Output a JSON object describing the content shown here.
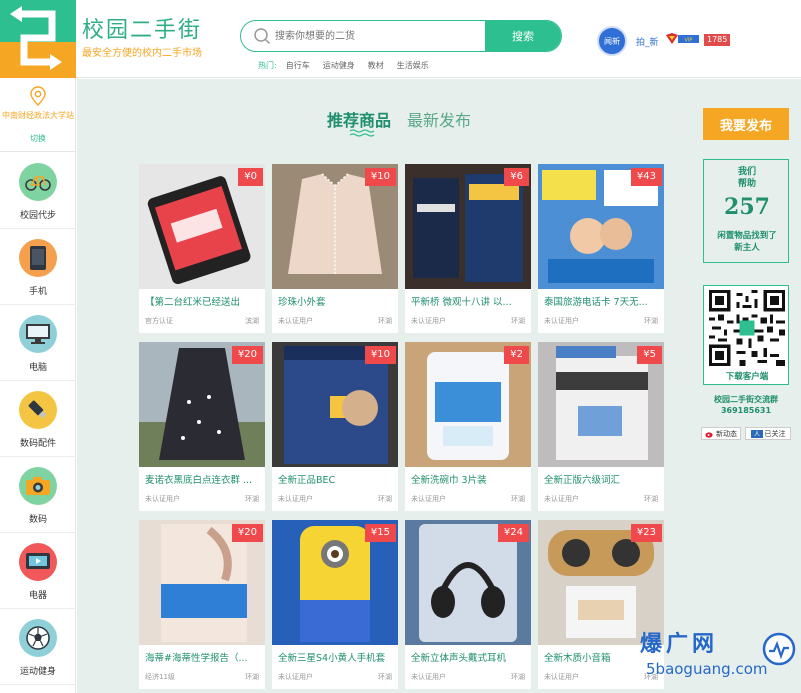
{
  "header": {
    "site_title": "校园二手街",
    "site_slogan": "最安全方便的校内二手市场",
    "search": {
      "placeholder": "搜索你想要的二货",
      "button_label": "搜索"
    },
    "hot_label": "热门:",
    "hot_tags": [
      "自行车",
      "运动健身",
      "教材",
      "生活娱乐"
    ],
    "user": {
      "avatar_text": "闻新",
      "name": "拍_新",
      "points": "1785"
    }
  },
  "sidebar": {
    "location_name": "中南财经政法大学站",
    "location_switch": "切换",
    "categories": [
      {
        "label": "校园代步",
        "icon": "bicycle-icon",
        "color": "#7fd3a1"
      },
      {
        "label": "手机",
        "icon": "phone-icon",
        "color": "#f5a04c"
      },
      {
        "label": "电脑",
        "icon": "computer-icon",
        "color": "#8fd0d8"
      },
      {
        "label": "数码配件",
        "icon": "usb-drive-icon",
        "color": "#f4c542"
      },
      {
        "label": "数码",
        "icon": "camera-icon",
        "color": "#7fd3a1"
      },
      {
        "label": "电器",
        "icon": "tv-icon",
        "color": "#f0585a"
      },
      {
        "label": "运动健身",
        "icon": "soccer-ball-icon",
        "color": "#8fd0d8"
      }
    ]
  },
  "tabs": {
    "recommended": "推荐商品",
    "latest": "最新发布"
  },
  "products": [
    {
      "price": "¥0",
      "title": "【第二台红米已经送出",
      "seller": "官方认证",
      "area": "滨湖",
      "bg": "#2a2a2a",
      "accent": "#e8434a"
    },
    {
      "price": "¥10",
      "title": "珍珠小外套",
      "seller": "未认证用户",
      "area": "环湖",
      "bg": "#8a7560",
      "accent": "#e9d4c6"
    },
    {
      "price": "¥6",
      "title": "平新桥 微观十八讲 以...",
      "seller": "未认证用户",
      "area": "环湖",
      "bg": "#3a2f2a",
      "accent": "#1b2a48"
    },
    {
      "price": "¥43",
      "title": "泰国旅游电话卡 7天无...",
      "seller": "未认证用户",
      "area": "环湖",
      "bg": "#3a7fc6",
      "accent": "#f4e04a"
    },
    {
      "price": "¥20",
      "title": "麦诺衣黑底白点连衣群 ...",
      "seller": "未认证用户",
      "area": "环湖",
      "bg": "#9aa3a8",
      "accent": "#2b2b33"
    },
    {
      "price": "¥10",
      "title": "全新正品BEC",
      "seller": "未认证用户",
      "area": "环湖",
      "bg": "#2c4a8a",
      "accent": "#f6c440"
    },
    {
      "price": "¥2",
      "title": "全新洗碗巾 3片装",
      "seller": "未认证用户",
      "area": "环湖",
      "bg": "#d9c2a0",
      "accent": "#3b8fd8"
    },
    {
      "price": "¥5",
      "title": "全新正版六级词汇",
      "seller": "未认证用户",
      "area": "环湖",
      "bg": "#c9c6c8",
      "accent": "#3c3c3c"
    },
    {
      "price": "¥20",
      "title": "海蒂#海蒂性学报告（...",
      "seller": "经济11级",
      "area": "环湖",
      "bg": "#e8d9cf",
      "accent": "#2f7fd6"
    },
    {
      "price": "¥15",
      "title": "全新三星S4小黄人手机套",
      "seller": "未认证用户",
      "area": "环湖",
      "bg": "#2760b8",
      "accent": "#f6d433"
    },
    {
      "price": "¥24",
      "title": "全新立体声头戴式耳机",
      "seller": "未认证用户",
      "area": "环湖",
      "bg": "#4d6a8a",
      "accent": "#222"
    },
    {
      "price": "¥23",
      "title": "全新木质小音箱",
      "seller": "未认证用户",
      "area": "环湖",
      "bg": "#d8d1c8",
      "accent": "#c79a5a"
    }
  ],
  "right": {
    "publish_label": "我要发布",
    "help_label": "我们\n帮助",
    "help_count": "257",
    "help_sub": "闲置物品找到了\n新主人",
    "qr_label": "下载客户端",
    "group_name": "校园二手街交流群",
    "group_number": "369185631",
    "weibo_label": "新动态",
    "renren_label": "已关注"
  },
  "watermark": {
    "text": "爆广网",
    "url": "5baoguang.com"
  }
}
